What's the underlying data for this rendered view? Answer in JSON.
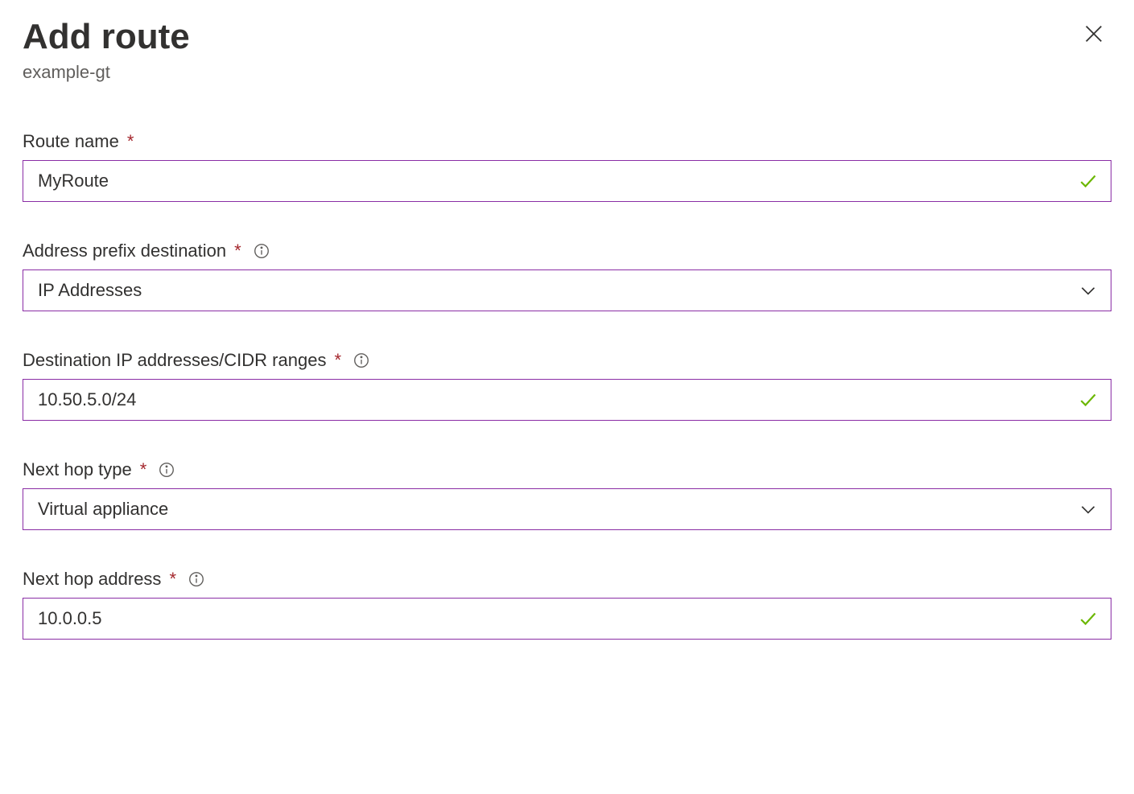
{
  "header": {
    "title": "Add route",
    "subtitle": "example-gt"
  },
  "form": {
    "routeName": {
      "label": "Route name",
      "value": "MyRoute",
      "required": true,
      "valid": true
    },
    "addressPrefix": {
      "label": "Address prefix destination",
      "value": "IP Addresses",
      "required": true,
      "hasInfo": true
    },
    "destinationCidr": {
      "label": "Destination IP addresses/CIDR ranges",
      "value": "10.50.5.0/24",
      "required": true,
      "hasInfo": true,
      "valid": true
    },
    "nextHopType": {
      "label": "Next hop type",
      "value": "Virtual appliance",
      "required": true,
      "hasInfo": true
    },
    "nextHopAddress": {
      "label": "Next hop address",
      "value": "10.0.0.5",
      "required": true,
      "hasInfo": true,
      "valid": true
    }
  }
}
